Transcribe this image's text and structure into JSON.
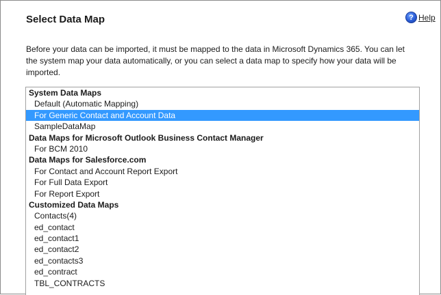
{
  "dialog": {
    "title": "Select Data Map",
    "help_label": "Help",
    "help_icon": "help-icon",
    "description": "Before your data can be imported, it must be mapped to the data in Microsoft Dynamics 365. You can let the system map your data automatically, or you can select a data map to specify how your data will be imported."
  },
  "listbox": {
    "selected_color": "#3399ff",
    "rows": [
      {
        "label": "System Data Maps",
        "kind": "group"
      },
      {
        "label": "Default (Automatic Mapping)",
        "kind": "item"
      },
      {
        "label": "For Generic Contact and Account Data",
        "kind": "item",
        "selected": true
      },
      {
        "label": "SampleDataMap",
        "kind": "item"
      },
      {
        "label": "Data Maps for Microsoft Outlook Business Contact Manager",
        "kind": "group"
      },
      {
        "label": "For BCM 2010",
        "kind": "item"
      },
      {
        "label": "Data Maps for Salesforce.com",
        "kind": "group"
      },
      {
        "label": "For Contact and Account Report Export",
        "kind": "item"
      },
      {
        "label": "For Full Data Export",
        "kind": "item"
      },
      {
        "label": "For Report Export",
        "kind": "item"
      },
      {
        "label": "Customized Data Maps",
        "kind": "group"
      },
      {
        "label": "Contacts(4)",
        "kind": "item"
      },
      {
        "label": "ed_contact",
        "kind": "item"
      },
      {
        "label": "ed_contact1",
        "kind": "item"
      },
      {
        "label": "ed_contact2",
        "kind": "item"
      },
      {
        "label": "ed_contacts3",
        "kind": "item"
      },
      {
        "label": "ed_contract",
        "kind": "item"
      },
      {
        "label": "TBL_CONTRACTS",
        "kind": "item"
      }
    ]
  }
}
